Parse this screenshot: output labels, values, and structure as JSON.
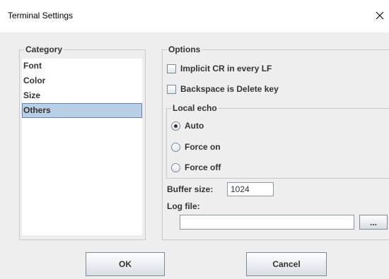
{
  "window": {
    "title": "Terminal Settings",
    "close_glyph": "✕"
  },
  "category": {
    "legend": "Category",
    "items": [
      "Font",
      "Color",
      "Size",
      "Others"
    ],
    "selected": "Others"
  },
  "options": {
    "legend": "Options",
    "implicit_cr": {
      "label": "Implicit CR in every LF",
      "checked": false
    },
    "backspace_delete": {
      "label": "Backspace is Delete key",
      "checked": false
    },
    "local_echo": {
      "legend": "Local echo",
      "choices": [
        "Auto",
        "Force on",
        "Force off"
      ],
      "selected": "Auto"
    },
    "buffer_size": {
      "label": "Buffer size:",
      "value": "1024"
    },
    "log_file": {
      "label": "Log file:",
      "value": "",
      "browse_label": "..."
    }
  },
  "buttons": {
    "ok": "OK",
    "cancel": "Cancel"
  },
  "colors": {
    "selection_bg": "#b8cfe5",
    "selection_border": "#6382bf",
    "dialog_bg": "#eeeeee"
  }
}
